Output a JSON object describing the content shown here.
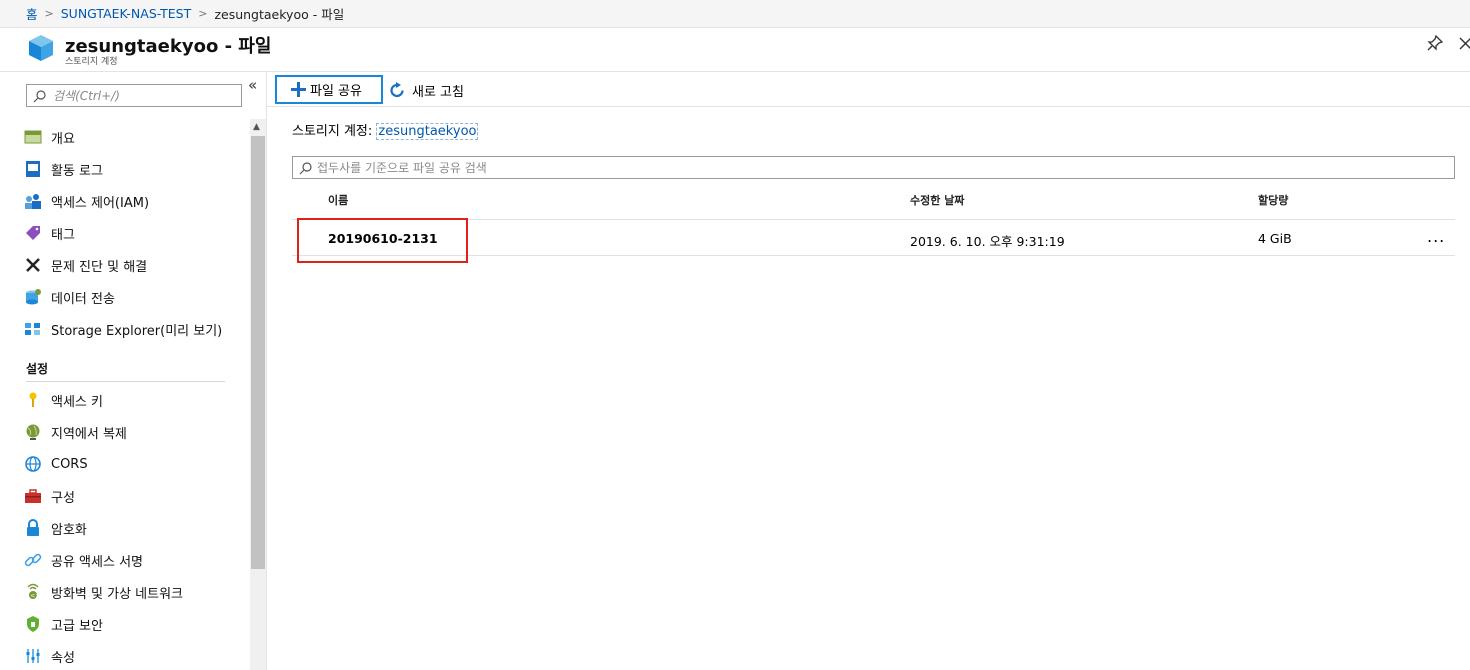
{
  "breadcrumb": {
    "home": "홈",
    "account": "SUNGTAEK-NAS-TEST",
    "current": "zesungtaekyoo - 파일"
  },
  "header": {
    "title": "zesungtaekyoo - 파일",
    "subtitle": "스토리지 계정"
  },
  "sidebar": {
    "search_placeholder": "검색(Ctrl+/)",
    "collapse_glyph": "«",
    "items": [
      {
        "label": "개요",
        "icon": "overview-icon"
      },
      {
        "label": "활동 로그",
        "icon": "activity-log-icon"
      },
      {
        "label": "액세스 제어(IAM)",
        "icon": "iam-icon"
      },
      {
        "label": "태그",
        "icon": "tag-icon"
      },
      {
        "label": "문제 진단 및 해결",
        "icon": "tools-icon"
      },
      {
        "label": "데이터 전송",
        "icon": "data-transfer-icon"
      },
      {
        "label": "Storage Explorer(미리 보기)",
        "icon": "storage-explorer-icon"
      }
    ],
    "settings_label": "설정",
    "settings_items": [
      {
        "label": "액세스 키",
        "icon": "key-icon"
      },
      {
        "label": "지역에서 복제",
        "icon": "globe-icon"
      },
      {
        "label": "CORS",
        "icon": "cors-icon"
      },
      {
        "label": "구성",
        "icon": "toolbox-icon"
      },
      {
        "label": "암호화",
        "icon": "lock-icon"
      },
      {
        "label": "공유 액세스 서명",
        "icon": "link-icon"
      },
      {
        "label": "방화벽 및 가상 네트워크",
        "icon": "firewall-icon"
      },
      {
        "label": "고급 보안",
        "icon": "shield-icon"
      },
      {
        "label": "속성",
        "icon": "properties-icon"
      }
    ]
  },
  "toolbar": {
    "add_label": "파일 공유",
    "refresh_label": "새로 고침"
  },
  "main": {
    "account_label": "스토리지 계정:",
    "account_value": "zesungtaekyoo",
    "filter_placeholder": "접두사를 기준으로 파일 공유 검색",
    "columns": [
      "이름",
      "수정한 날짜",
      "할당량"
    ],
    "rows": [
      {
        "name": "20190610-2131",
        "modified": "2019. 6. 10. 오후 9:31:19",
        "quota": "4 GiB",
        "more": "..."
      }
    ]
  },
  "colors": {
    "link": "#0058ad",
    "accent": "#1a86d8",
    "highlight": "#e0201c"
  }
}
